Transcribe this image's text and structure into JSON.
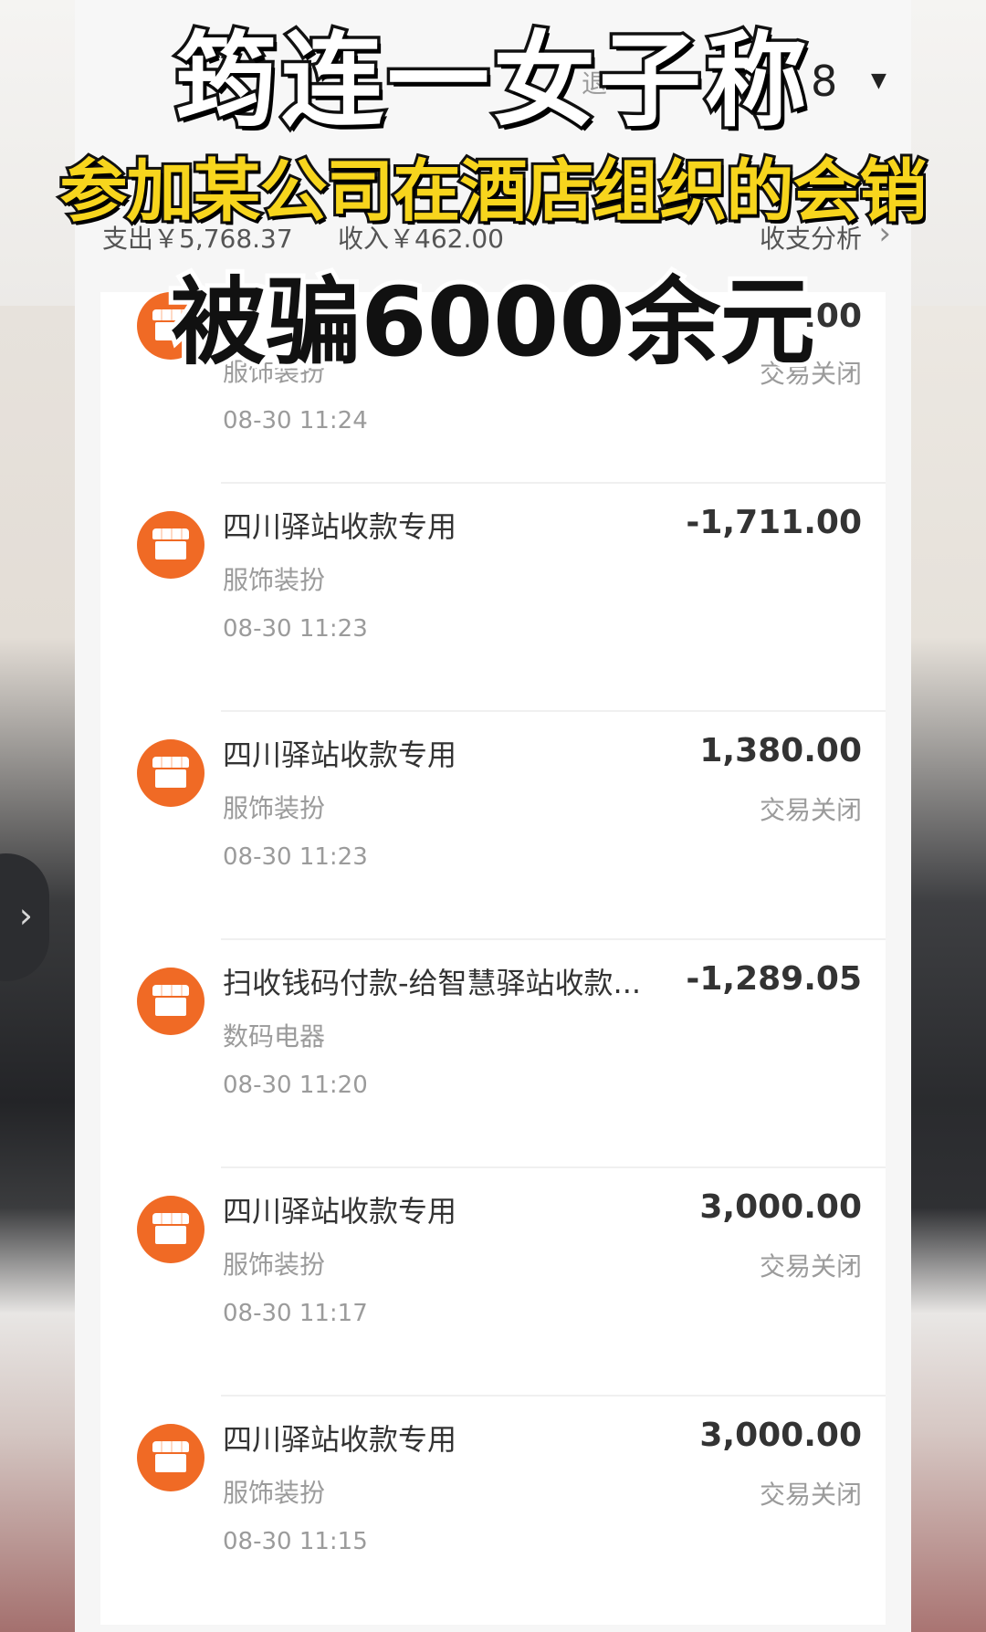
{
  "headline": {
    "line1": "筠连一女子称",
    "line2": "参加某公司在酒店组织的会销",
    "line3": "被骗6000余元"
  },
  "topbar": {
    "filter_link": "退",
    "more_icon": "8"
  },
  "summary": {
    "expense": "支出￥5,768.37",
    "income": "收入￥462.00",
    "analysis": "收支分析"
  },
  "transactions": [
    {
      "merchant": "",
      "category": "服饰装扮",
      "time": "08-30 11:24",
      "amount": ".00",
      "status": "交易关闭"
    },
    {
      "merchant": "四川驿站收款专用",
      "category": "服饰装扮",
      "time": "08-30 11:23",
      "amount": "-1,711.00",
      "status": ""
    },
    {
      "merchant": "四川驿站收款专用",
      "category": "服饰装扮",
      "time": "08-30 11:23",
      "amount": "1,380.00",
      "status": "交易关闭"
    },
    {
      "merchant": "扫收钱码付款-给智慧驿站收款...",
      "category": "数码电器",
      "time": "08-30 11:20",
      "amount": "-1,289.05",
      "status": ""
    },
    {
      "merchant": "四川驿站收款专用",
      "category": "服饰装扮",
      "time": "08-30 11:17",
      "amount": "3,000.00",
      "status": "交易关闭"
    },
    {
      "merchant": "四川驿站收款专用",
      "category": "服饰装扮",
      "time": "08-30 11:15",
      "amount": "3,000.00",
      "status": "交易关闭"
    }
  ],
  "colors": {
    "merchant_icon": "#f06a25",
    "caption_yellow": "#f7d51d"
  },
  "icons": {
    "merchant": "shop-icon",
    "analysis": "chevron-right-icon",
    "side_nav": "chevron-right-icon"
  }
}
